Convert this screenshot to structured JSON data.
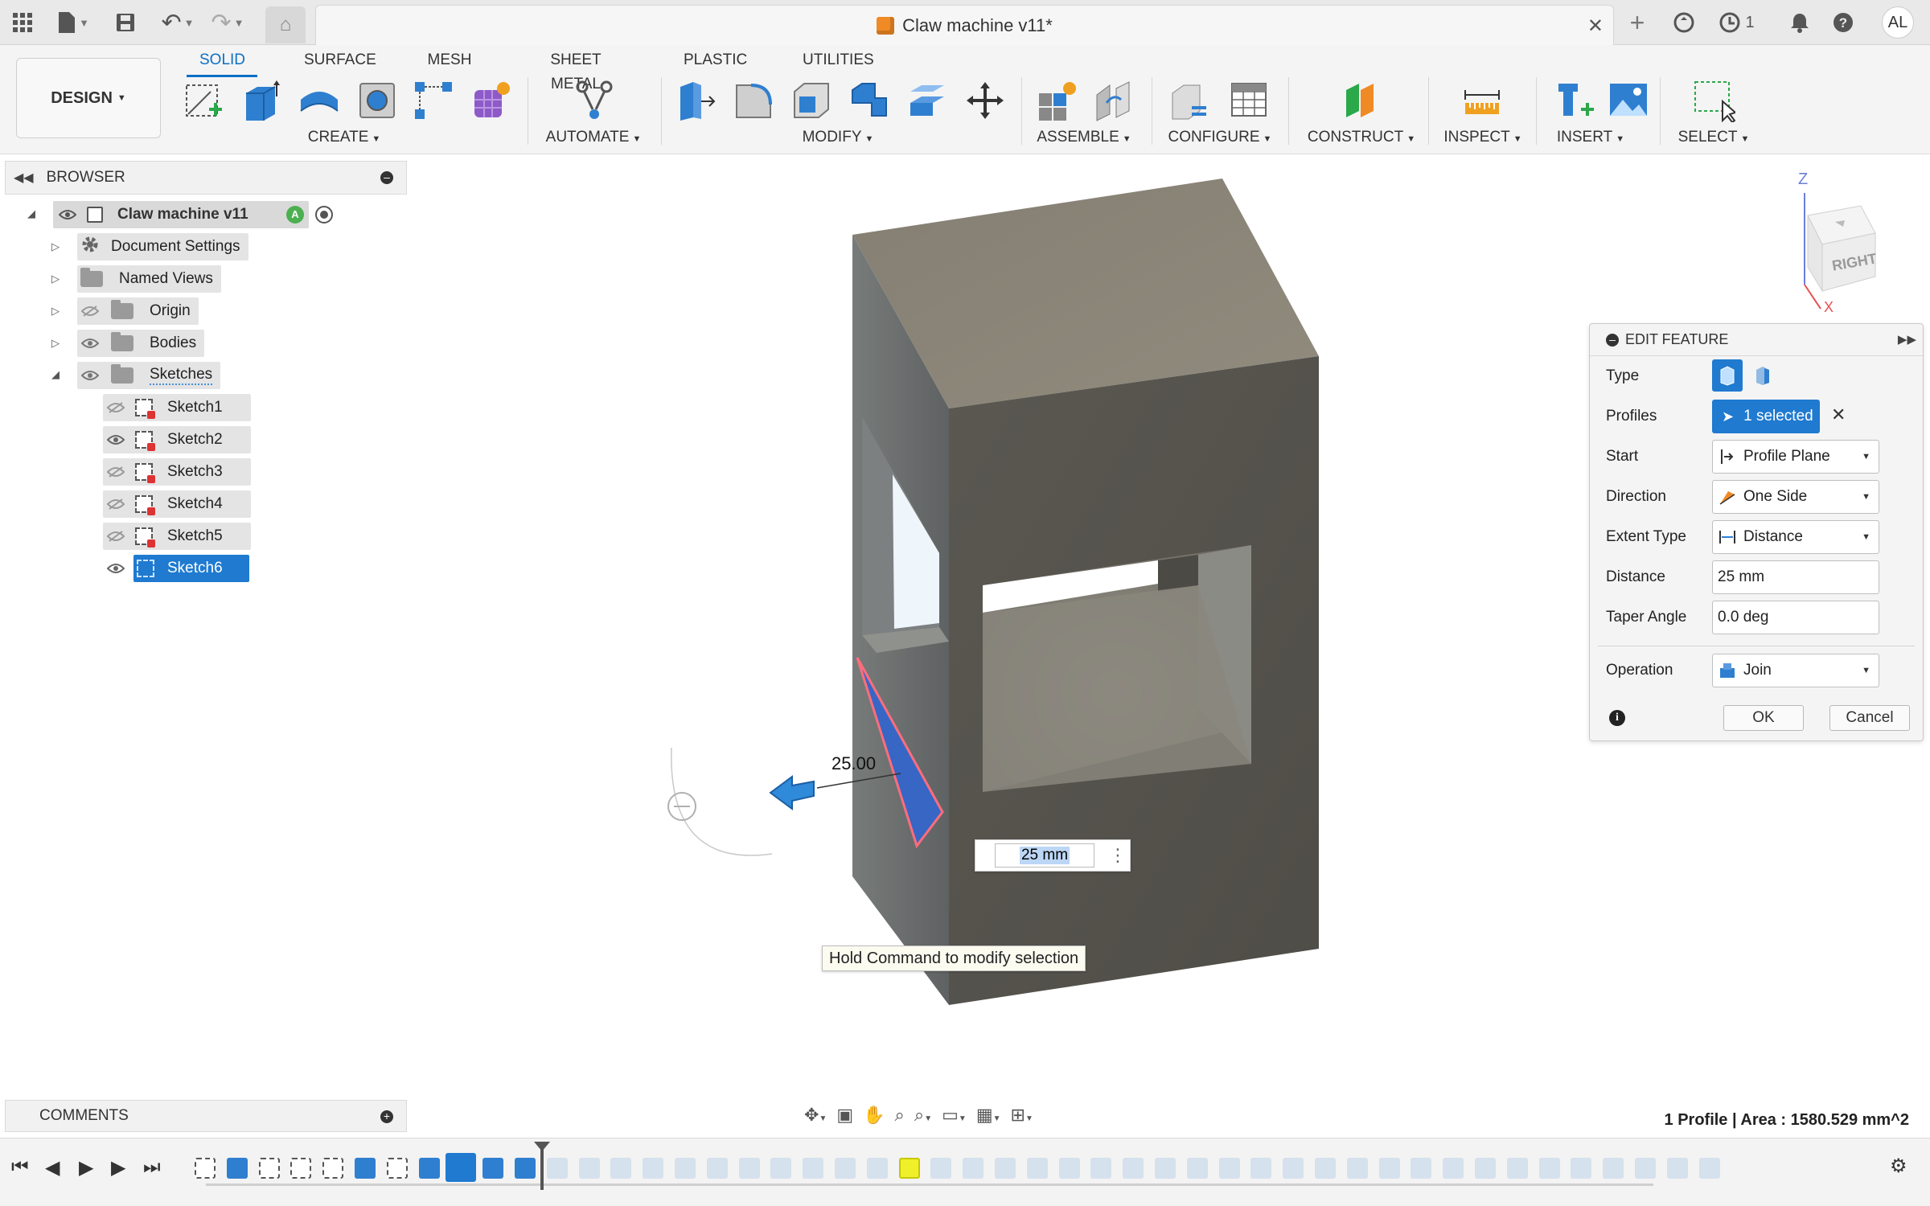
{
  "window": {
    "title": "Claw machine v11*",
    "notification_count": "1",
    "user_initials": "AL"
  },
  "toolbar": {
    "workspace": "DESIGN",
    "tabs": [
      "SOLID",
      "SURFACE",
      "MESH",
      "SHEET METAL",
      "PLASTIC",
      "UTILITIES"
    ],
    "active_tab": "SOLID",
    "groups": [
      "CREATE",
      "AUTOMATE",
      "MODIFY",
      "ASSEMBLE",
      "CONFIGURE",
      "CONSTRUCT",
      "INSPECT",
      "INSERT",
      "SELECT"
    ]
  },
  "browser": {
    "title": "BROWSER",
    "root": "Claw machine v11",
    "items": [
      {
        "label": "Document Settings",
        "icon": "gear-icon"
      },
      {
        "label": "Named Views",
        "icon": "folder-icon"
      },
      {
        "label": "Origin",
        "icon": "folder-icon"
      },
      {
        "label": "Bodies",
        "icon": "folder-icon"
      },
      {
        "label": "Sketches",
        "icon": "folder-icon"
      }
    ],
    "sketches": [
      "Sketch1",
      "Sketch2",
      "Sketch3",
      "Sketch4",
      "Sketch5",
      "Sketch6"
    ],
    "selected_sketch": "Sketch6"
  },
  "comments": {
    "title": "COMMENTS"
  },
  "viewcube": {
    "face": "RIGHT",
    "axis_z": "Z",
    "axis_x": "X"
  },
  "viewport": {
    "dimension_label": "25.00",
    "input_value": "25 mm",
    "tooltip": "Hold Command to modify selection"
  },
  "edit_feature": {
    "title": "EDIT FEATURE",
    "type_label": "Type",
    "profiles_label": "Profiles",
    "profiles_value": "1 selected",
    "start_label": "Start",
    "start_value": "Profile Plane",
    "direction_label": "Direction",
    "direction_value": "One Side",
    "extent_label": "Extent Type",
    "extent_value": "Distance",
    "distance_label": "Distance",
    "distance_value": "25 mm",
    "taper_label": "Taper Angle",
    "taper_value": "0.0 deg",
    "operation_label": "Operation",
    "operation_value": "Join",
    "ok": "OK",
    "cancel": "Cancel"
  },
  "status": {
    "text": "1 Profile | Area : 1580.529 mm^2"
  },
  "colors": {
    "accent": "#0d6fc4",
    "selection": "#1f7ad0",
    "model_top": "#8b8578",
    "model_front": "#56544d",
    "model_side": "#6c7070",
    "profile_fill": "#3766c4"
  }
}
